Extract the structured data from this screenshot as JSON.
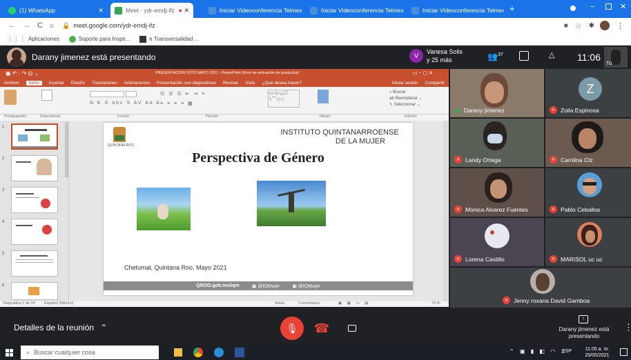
{
  "browser": {
    "tabs": [
      {
        "label": "(1) WhatsApp",
        "color": "#25d366"
      },
      {
        "label": "Meet - ydr-emdj-ifz",
        "color": "#34a853"
      },
      {
        "label": "Iniciar Videoconferencia Telmex",
        "color": "#4a90d9"
      },
      {
        "label": "Iniciar Videoconferencia Telmex",
        "color": "#4a90d9"
      },
      {
        "label": "Iniciar Videoconferencia Telmex",
        "color": "#4a90d9"
      }
    ],
    "new_tab": "+",
    "url": "meet.google.com/ydr-emdj-ifz",
    "bookmarks": [
      "Aplicaciones",
      "Soporte para Inspir...",
      "e Transversalidad ..."
    ]
  },
  "meet": {
    "presenting_text": "Darany jimenez está presentando",
    "host_initial": "V",
    "host_name": "Vanesa Solis",
    "host_more": "y 25 más",
    "participants_count": "37",
    "clock": "11:06",
    "self_label": "Tú",
    "details_label": "Detalles de la reunión",
    "presenter_caption": "Darany jimenez está presentando"
  },
  "ppt": {
    "window_title": "PRESENTACION  FOTO MAYO 2021 - PowerPoint (Error de activación de productos)",
    "tabs": [
      "Archivo",
      "Inicio",
      "Insertar",
      "Diseño",
      "Transiciones",
      "Animaciones",
      "Presentación con diapositivas",
      "Revisar",
      "Vista",
      "¿Qué desea hacer?"
    ],
    "signin": "Iniciar sesión",
    "share": "Compartir",
    "groups": [
      "Portapapeles",
      "Diapositivas",
      "Fuente",
      "Párrafo",
      "Dibujo",
      "Edición"
    ],
    "status_left": "Diapositiva 1 de 20",
    "status_lang": "Español (México)",
    "status_notes": "Notas",
    "status_comments": "Comentarios",
    "zoom": "74 %",
    "thumb_numbers": [
      "1",
      "2",
      "3",
      "4",
      "5",
      "6"
    ]
  },
  "slide": {
    "institution_line1": "INSTITUTO QUINTANARROENSE",
    "institution_line2": "DE LA MUJER",
    "logo_text": "QUINTANA ROO",
    "title": "Perspectiva de Género",
    "place_date": "Chetumal, Quintana Roo, Mayo 2021",
    "footer_site": "QROO.gob.mx/iqm",
    "footer_fb": "@IQMujer",
    "footer_tw": "@IQMujer"
  },
  "participants": [
    {
      "name": "Darany jimenez",
      "muted": false,
      "bg": "#8a7a6a"
    },
    {
      "name": "Zoila Espinosa",
      "muted": true,
      "bg": "#3c4043",
      "initial": "Z",
      "avatar_color": "#7a9aa5"
    },
    {
      "name": "Landy Ortega",
      "muted": true,
      "bg": "#5a5f55"
    },
    {
      "name": "Carolina Ctz",
      "muted": true,
      "bg": "#6b5a50"
    },
    {
      "name": "Monica Alvarez Fuentes",
      "muted": true,
      "bg": "#5e5048"
    },
    {
      "name": "Pablo Ceballos",
      "muted": true,
      "bg": "#3c4043"
    },
    {
      "name": "Lorena Castillo",
      "muted": true,
      "bg": "#4a4550"
    },
    {
      "name": "MARISOL uc uc",
      "muted": true,
      "bg": "#3c4043"
    },
    {
      "name": "Jenny roxana David Gamboa",
      "muted": true,
      "bg": "#3c4043"
    }
  ],
  "taskbar": {
    "search_placeholder": "Buscar cualquier cosa",
    "lang": "ESP",
    "time": "11:05 a. m.",
    "date": "25/05/2021"
  },
  "colors": {
    "chrome_blue": "#1a73e8",
    "ppt_orange": "#c6502f",
    "meet_red": "#ea4335",
    "meet_bg": "#202124"
  }
}
